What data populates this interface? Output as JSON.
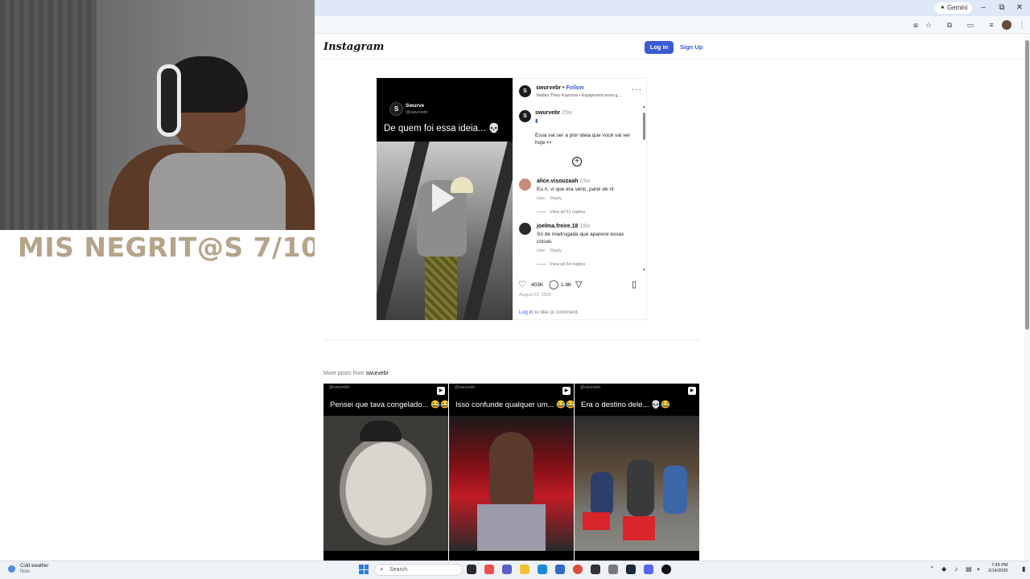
{
  "overlay": {
    "text": "MIS NEGRIT@S 7/10"
  },
  "browser": {
    "gemini_label": "Gemini",
    "window_controls": {
      "minimize": "–",
      "restore": "⧉",
      "close": "✕"
    }
  },
  "instagram": {
    "logo": "Instagram",
    "login_label": "Log in",
    "signup_label": "Sign Up"
  },
  "post": {
    "media": {
      "account_name": "Swurve",
      "account_handle": "@swurvebr",
      "caption": "De quem foi essa ideia... 💀"
    },
    "author": "swurvebr",
    "follow_label": "Follow",
    "audio": "Valdez Theo Kazuma • Equipment sooo g...",
    "caption_author": "swurvebr",
    "caption_time": "25w",
    "caption_text": "Essa vai ser a pior ideia que você vai ver hoje 👀",
    "comments": [
      {
        "user": "alice.visouzaah",
        "time": "23w",
        "text": "Eu ri, vi que era sério, parei de rir",
        "like": "Like",
        "reply": "Reply",
        "view_all": "View all 91 replies"
      },
      {
        "user": "joelma.freire.18",
        "time": "19w",
        "text": "Só de madrugada que aparece essas coisas",
        "like": "Like",
        "reply": "Reply",
        "view_all": "View all 34 replies"
      }
    ],
    "likes": "403K",
    "comment_count": "1.9K",
    "date": "August 22, 2025",
    "login_prompt_link": "Log in",
    "login_prompt_text": " to like or comment."
  },
  "more_posts": {
    "label": "More posts from ",
    "account": "swurvebr",
    "tiles": [
      {
        "handle": "@swurvebr",
        "caption": "Pensei que tava congelado... 😂😂"
      },
      {
        "handle": "@swurvebr",
        "caption": "Isso confunde qualquer um... 😂😂"
      },
      {
        "handle": "@swurvebr",
        "caption": "Era o destino dele... 💀😂"
      }
    ]
  },
  "taskbar": {
    "weather_title": "Cold weather",
    "weather_sub": "Now",
    "search_placeholder": "Search",
    "time": "7:49 PM",
    "date": "2/14/2026"
  }
}
